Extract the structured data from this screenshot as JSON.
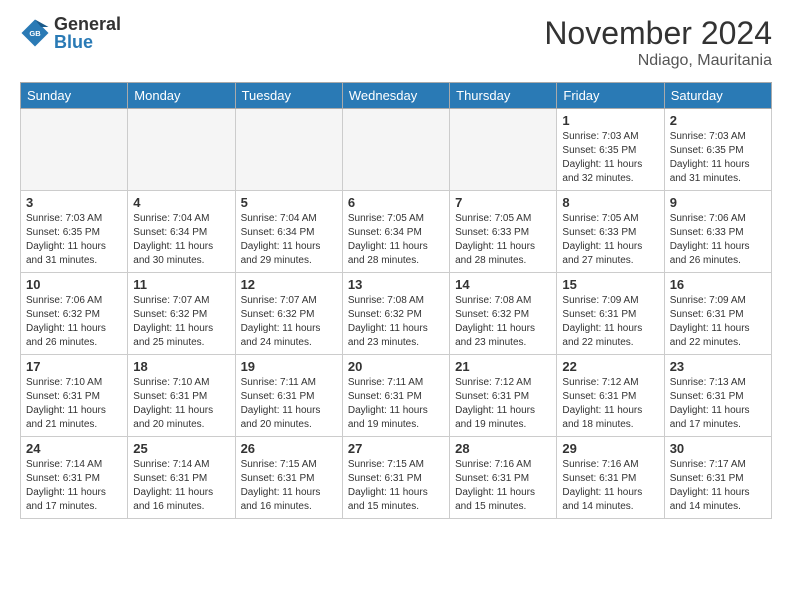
{
  "logo": {
    "general": "General",
    "blue": "Blue"
  },
  "title": "November 2024",
  "location": "Ndiago, Mauritania",
  "days_header": [
    "Sunday",
    "Monday",
    "Tuesday",
    "Wednesday",
    "Thursday",
    "Friday",
    "Saturday"
  ],
  "weeks": [
    [
      {
        "day": "",
        "info": ""
      },
      {
        "day": "",
        "info": ""
      },
      {
        "day": "",
        "info": ""
      },
      {
        "day": "",
        "info": ""
      },
      {
        "day": "",
        "info": ""
      },
      {
        "day": "1",
        "info": "Sunrise: 7:03 AM\nSunset: 6:35 PM\nDaylight: 11 hours\nand 32 minutes."
      },
      {
        "day": "2",
        "info": "Sunrise: 7:03 AM\nSunset: 6:35 PM\nDaylight: 11 hours\nand 31 minutes."
      }
    ],
    [
      {
        "day": "3",
        "info": "Sunrise: 7:03 AM\nSunset: 6:35 PM\nDaylight: 11 hours\nand 31 minutes."
      },
      {
        "day": "4",
        "info": "Sunrise: 7:04 AM\nSunset: 6:34 PM\nDaylight: 11 hours\nand 30 minutes."
      },
      {
        "day": "5",
        "info": "Sunrise: 7:04 AM\nSunset: 6:34 PM\nDaylight: 11 hours\nand 29 minutes."
      },
      {
        "day": "6",
        "info": "Sunrise: 7:05 AM\nSunset: 6:34 PM\nDaylight: 11 hours\nand 28 minutes."
      },
      {
        "day": "7",
        "info": "Sunrise: 7:05 AM\nSunset: 6:33 PM\nDaylight: 11 hours\nand 28 minutes."
      },
      {
        "day": "8",
        "info": "Sunrise: 7:05 AM\nSunset: 6:33 PM\nDaylight: 11 hours\nand 27 minutes."
      },
      {
        "day": "9",
        "info": "Sunrise: 7:06 AM\nSunset: 6:33 PM\nDaylight: 11 hours\nand 26 minutes."
      }
    ],
    [
      {
        "day": "10",
        "info": "Sunrise: 7:06 AM\nSunset: 6:32 PM\nDaylight: 11 hours\nand 26 minutes."
      },
      {
        "day": "11",
        "info": "Sunrise: 7:07 AM\nSunset: 6:32 PM\nDaylight: 11 hours\nand 25 minutes."
      },
      {
        "day": "12",
        "info": "Sunrise: 7:07 AM\nSunset: 6:32 PM\nDaylight: 11 hours\nand 24 minutes."
      },
      {
        "day": "13",
        "info": "Sunrise: 7:08 AM\nSunset: 6:32 PM\nDaylight: 11 hours\nand 23 minutes."
      },
      {
        "day": "14",
        "info": "Sunrise: 7:08 AM\nSunset: 6:32 PM\nDaylight: 11 hours\nand 23 minutes."
      },
      {
        "day": "15",
        "info": "Sunrise: 7:09 AM\nSunset: 6:31 PM\nDaylight: 11 hours\nand 22 minutes."
      },
      {
        "day": "16",
        "info": "Sunrise: 7:09 AM\nSunset: 6:31 PM\nDaylight: 11 hours\nand 22 minutes."
      }
    ],
    [
      {
        "day": "17",
        "info": "Sunrise: 7:10 AM\nSunset: 6:31 PM\nDaylight: 11 hours\nand 21 minutes."
      },
      {
        "day": "18",
        "info": "Sunrise: 7:10 AM\nSunset: 6:31 PM\nDaylight: 11 hours\nand 20 minutes."
      },
      {
        "day": "19",
        "info": "Sunrise: 7:11 AM\nSunset: 6:31 PM\nDaylight: 11 hours\nand 20 minutes."
      },
      {
        "day": "20",
        "info": "Sunrise: 7:11 AM\nSunset: 6:31 PM\nDaylight: 11 hours\nand 19 minutes."
      },
      {
        "day": "21",
        "info": "Sunrise: 7:12 AM\nSunset: 6:31 PM\nDaylight: 11 hours\nand 19 minutes."
      },
      {
        "day": "22",
        "info": "Sunrise: 7:12 AM\nSunset: 6:31 PM\nDaylight: 11 hours\nand 18 minutes."
      },
      {
        "day": "23",
        "info": "Sunrise: 7:13 AM\nSunset: 6:31 PM\nDaylight: 11 hours\nand 17 minutes."
      }
    ],
    [
      {
        "day": "24",
        "info": "Sunrise: 7:14 AM\nSunset: 6:31 PM\nDaylight: 11 hours\nand 17 minutes."
      },
      {
        "day": "25",
        "info": "Sunrise: 7:14 AM\nSunset: 6:31 PM\nDaylight: 11 hours\nand 16 minutes."
      },
      {
        "day": "26",
        "info": "Sunrise: 7:15 AM\nSunset: 6:31 PM\nDaylight: 11 hours\nand 16 minutes."
      },
      {
        "day": "27",
        "info": "Sunrise: 7:15 AM\nSunset: 6:31 PM\nDaylight: 11 hours\nand 15 minutes."
      },
      {
        "day": "28",
        "info": "Sunrise: 7:16 AM\nSunset: 6:31 PM\nDaylight: 11 hours\nand 15 minutes."
      },
      {
        "day": "29",
        "info": "Sunrise: 7:16 AM\nSunset: 6:31 PM\nDaylight: 11 hours\nand 14 minutes."
      },
      {
        "day": "30",
        "info": "Sunrise: 7:17 AM\nSunset: 6:31 PM\nDaylight: 11 hours\nand 14 minutes."
      }
    ]
  ]
}
